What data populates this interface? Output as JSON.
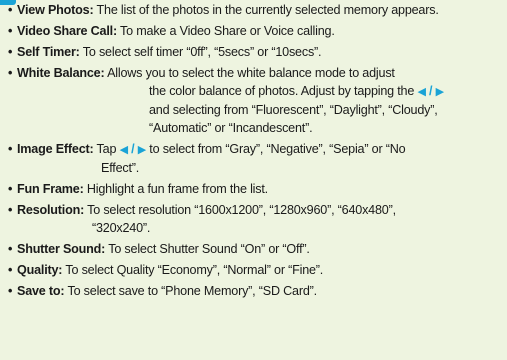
{
  "items": [
    {
      "term": "View Photos:",
      "text": " The list of the photos in the currently selected memory appears."
    },
    {
      "term": "Video Share Call:",
      "text": " To make a Video Share or Voice calling."
    },
    {
      "term": "Self Timer:",
      "text": " To select self timer “0ff”, “5secs” or “10secs”."
    },
    {
      "term": "White Balance:",
      "text": " Allows you to select the white balance mode to adjust",
      "cont": [
        "the color balance of photos. Adjust by tapping the ",
        " and selecting from “Fluorescent”, “Daylight”, “Cloudy”,",
        "“Automatic” or “Incandescent”."
      ]
    },
    {
      "term": "Image Effect:",
      "text_pre": " Tap ",
      "text_post": " to select from “Gray”, “Negative”, “Sepia” or “No",
      "cont": [
        "Effect”."
      ]
    },
    {
      "term": "Fun Frame:",
      "text": " Highlight a fun frame from the list."
    },
    {
      "term": "Resolution:",
      "text": " To select resolution “1600x1200”, “1280x960”, “640x480”,",
      "cont": [
        "“320x240”."
      ]
    },
    {
      "term": "Shutter Sound:",
      "text": " To select Shutter Sound “On” or “Off”."
    },
    {
      "term": "Quality:",
      "text": " To select Quality “Economy”, “Normal” or “Fine”."
    },
    {
      "term": "Save to:",
      "text": " To select save to “Phone Memory”, “SD Card”."
    }
  ],
  "bullet": "•",
  "arrow_left": "◀",
  "arrow_right": "▶",
  "arrow_sep": " / ",
  "accent_color": "#1aa3d6"
}
